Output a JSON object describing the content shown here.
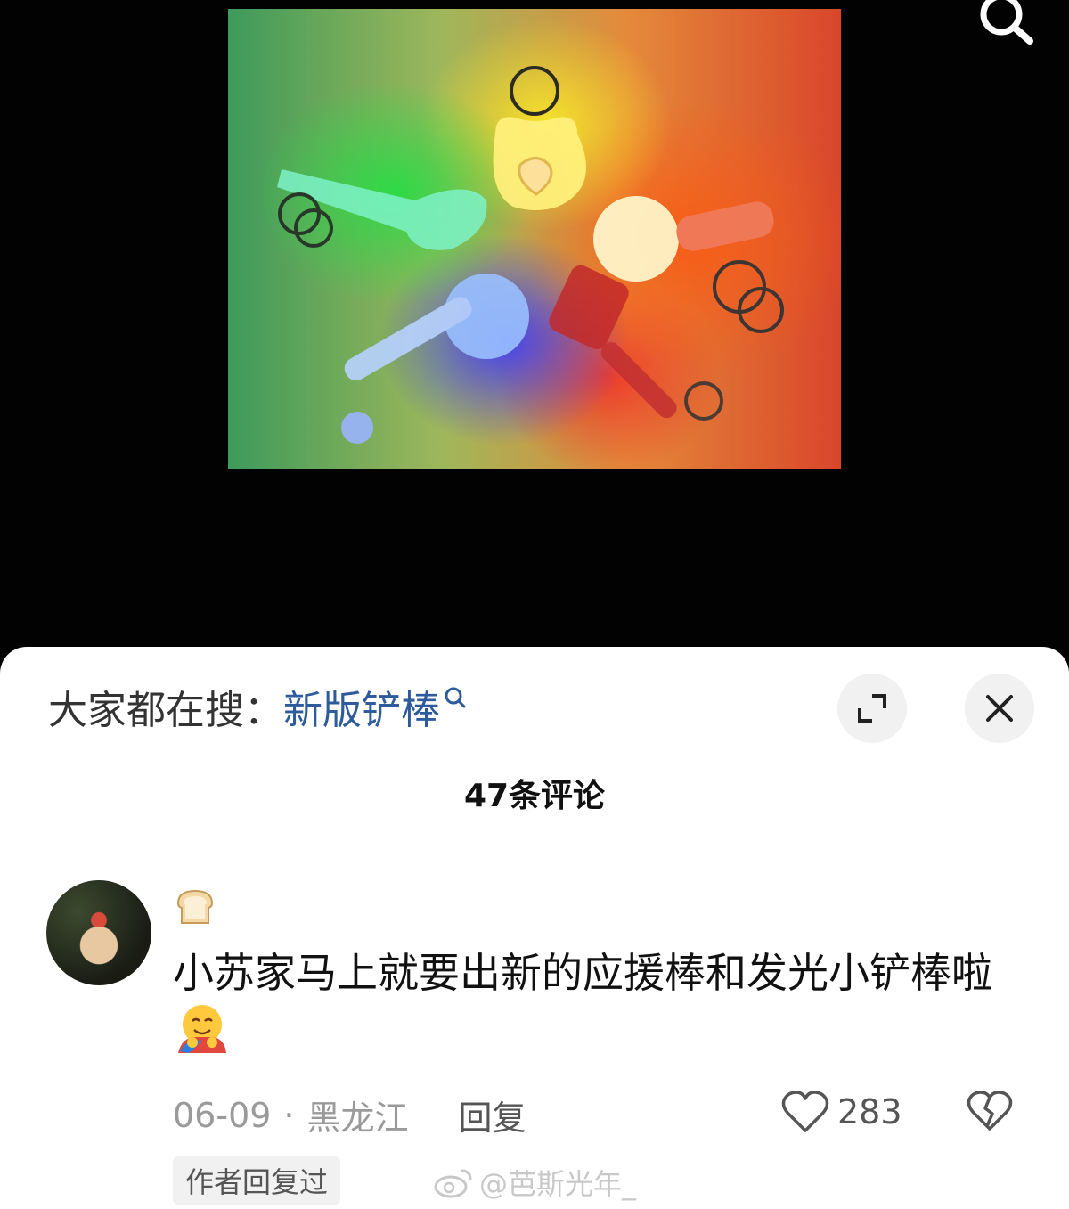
{
  "trending": {
    "label": "大家都在搜：",
    "term": "新版铲棒"
  },
  "comments": {
    "count_label": "47条评论"
  },
  "comment": {
    "text": "小苏家马上就要出新的应援棒和发光小铲棒啦",
    "date": "06-09",
    "separator": "·",
    "location": "黑龙江",
    "reply_label": "回复",
    "like_count": "283",
    "author_replied": "作者回复过"
  },
  "watermark": {
    "text": "@芭斯光年_"
  },
  "icons": {
    "top_search": "search-icon",
    "expand": "expand-icon",
    "close": "close-icon",
    "like": "heart-icon",
    "dislike": "broken-heart-icon",
    "username": "bread-emoji",
    "reaction": "hugging-face-emoji",
    "watermark": "weibo-icon"
  },
  "colors": {
    "trending_term": "#2d5b9c",
    "sheet_background": "#ffffff",
    "media_background": "#020202"
  }
}
